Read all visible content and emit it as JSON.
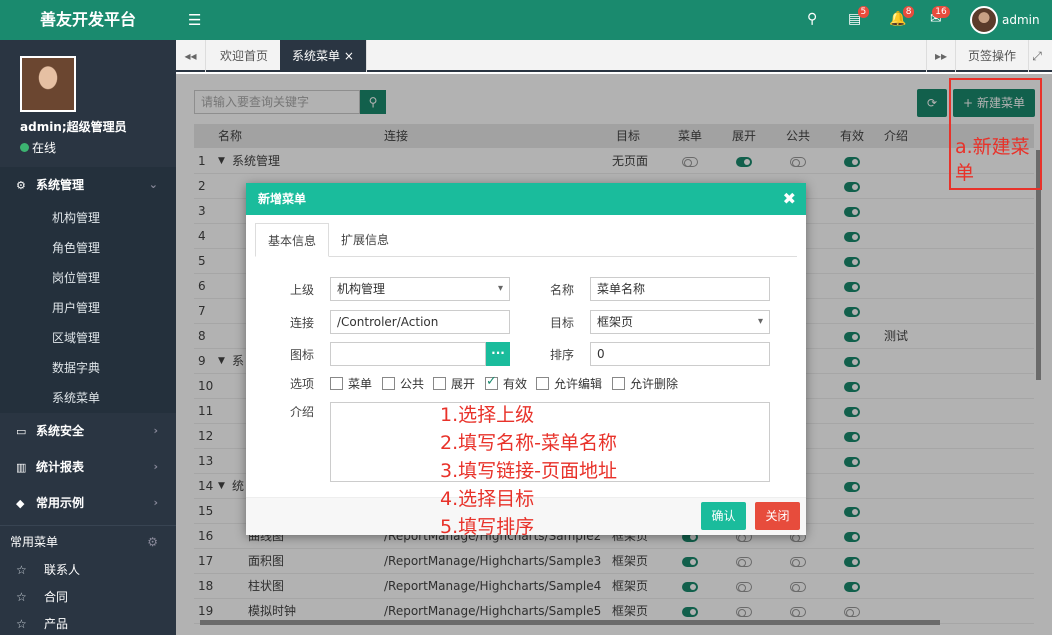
{
  "app": {
    "title": "善友开发平台",
    "user": "admin"
  },
  "header": {
    "badges": {
      "tasks": "5",
      "notifications": "8",
      "messages": "16"
    }
  },
  "sidebar": {
    "user_name": "admin;超级管理员",
    "status": "在线",
    "menu": [
      {
        "label": "系统管理",
        "children": [
          "机构管理",
          "角色管理",
          "岗位管理",
          "用户管理",
          "区域管理",
          "数据字典",
          "系统菜单"
        ]
      },
      {
        "label": "系统安全"
      },
      {
        "label": "统计报表"
      },
      {
        "label": "常用示例"
      }
    ],
    "common_title": "常用菜单",
    "common_items": [
      "联系人",
      "合同",
      "产品"
    ]
  },
  "tabs": {
    "home": "欢迎首页",
    "current": "系统菜单",
    "ops": "页签操作"
  },
  "toolbar": {
    "search_placeholder": "请输入要查询关键字",
    "new_label": "新建菜单"
  },
  "table": {
    "headers": [
      "名称",
      "连接",
      "目标",
      "菜单",
      "展开",
      "公共",
      "有效",
      "介绍"
    ],
    "rows": [
      {
        "n": "1",
        "name": "系统管理",
        "url": "",
        "target": "无页面",
        "tg": [
          0,
          1,
          0,
          1
        ],
        "desc": ""
      },
      {
        "n": "2",
        "name": "",
        "url": "",
        "target": "",
        "tg": [
          null,
          null,
          null,
          1
        ],
        "desc": ""
      },
      {
        "n": "3",
        "name": "",
        "url": "",
        "target": "",
        "tg": [
          null,
          null,
          null,
          1
        ],
        "desc": ""
      },
      {
        "n": "4",
        "name": "",
        "url": "",
        "target": "",
        "tg": [
          null,
          null,
          null,
          1
        ],
        "desc": ""
      },
      {
        "n": "5",
        "name": "",
        "url": "",
        "target": "",
        "tg": [
          null,
          null,
          null,
          1
        ],
        "desc": ""
      },
      {
        "n": "6",
        "name": "",
        "url": "",
        "target": "",
        "tg": [
          null,
          null,
          null,
          1
        ],
        "desc": ""
      },
      {
        "n": "7",
        "name": "",
        "url": "",
        "target": "",
        "tg": [
          null,
          null,
          null,
          1
        ],
        "desc": ""
      },
      {
        "n": "8",
        "name": "",
        "url": "",
        "target": "",
        "tg": [
          null,
          null,
          null,
          1
        ],
        "desc": "测试"
      },
      {
        "n": "9",
        "name": "系",
        "url": "",
        "target": "",
        "tg": [
          null,
          null,
          null,
          1
        ],
        "desc": ""
      },
      {
        "n": "10",
        "name": "",
        "url": "",
        "target": "",
        "tg": [
          null,
          null,
          null,
          1
        ],
        "desc": ""
      },
      {
        "n": "11",
        "name": "",
        "url": "",
        "target": "",
        "tg": [
          null,
          null,
          null,
          1
        ],
        "desc": ""
      },
      {
        "n": "12",
        "name": "",
        "url": "",
        "target": "",
        "tg": [
          null,
          null,
          null,
          1
        ],
        "desc": ""
      },
      {
        "n": "13",
        "name": "",
        "url": "",
        "target": "",
        "tg": [
          null,
          null,
          null,
          1
        ],
        "desc": ""
      },
      {
        "n": "14",
        "name": "统",
        "url": "",
        "target": "",
        "tg": [
          null,
          null,
          null,
          1
        ],
        "desc": ""
      },
      {
        "n": "15",
        "name": "",
        "url": "",
        "target": "",
        "tg": [
          null,
          null,
          null,
          1
        ],
        "desc": ""
      },
      {
        "n": "16",
        "name": "曲线图",
        "url": "/ReportManage/Highcharts/Sample2",
        "target": "框架页",
        "tg": [
          1,
          0,
          0,
          1
        ],
        "desc": ""
      },
      {
        "n": "17",
        "name": "面积图",
        "url": "/ReportManage/Highcharts/Sample3",
        "target": "框架页",
        "tg": [
          1,
          0,
          0,
          1
        ],
        "desc": ""
      },
      {
        "n": "18",
        "name": "柱状图",
        "url": "/ReportManage/Highcharts/Sample4",
        "target": "框架页",
        "tg": [
          1,
          0,
          0,
          1
        ],
        "desc": ""
      },
      {
        "n": "19",
        "name": "模拟时钟",
        "url": "/ReportManage/Highcharts/Sample5",
        "target": "框架页",
        "tg": [
          1,
          0,
          0,
          0
        ],
        "desc": ""
      }
    ]
  },
  "modal": {
    "title": "新增菜单",
    "tabs": [
      "基本信息",
      "扩展信息"
    ],
    "labels": {
      "parent": "上级",
      "name": "名称",
      "url": "连接",
      "target": "目标",
      "icon": "图标",
      "sort": "排序",
      "options": "选项",
      "desc": "介绍"
    },
    "values": {
      "parent": "机构管理",
      "name": "菜单名称",
      "url": "/Controler/Action",
      "target": "框架页",
      "icon": "",
      "sort": "0"
    },
    "icon_btn": "···",
    "options": [
      {
        "label": "菜单",
        "checked": false
      },
      {
        "label": "公共",
        "checked": false
      },
      {
        "label": "展开",
        "checked": false
      },
      {
        "label": "有效",
        "checked": true
      },
      {
        "label": "允许编辑",
        "checked": false
      },
      {
        "label": "允许删除",
        "checked": false
      }
    ],
    "ok": "确认",
    "cancel": "关闭"
  },
  "annotations": {
    "new_menu": "a.新建菜单",
    "steps": [
      "1.选择上级",
      "2.填写名称-菜单名称",
      "3.填写链接-页面地址",
      "4.选择目标",
      "5.填写排序"
    ]
  },
  "icons": [
    "menu-icon",
    "search-icon",
    "tasks-icon",
    "bell-icon",
    "envelope-icon",
    "refresh-icon",
    "plus-icon",
    "close-icon",
    "star-icon",
    "gear-icon",
    "chevron-icon"
  ],
  "colors": {
    "primary": "#1a8a6e",
    "modal_header": "#1abc9c",
    "sidebar": "#2a3542",
    "danger": "#e74c3c",
    "annotation": "#e8322a"
  }
}
